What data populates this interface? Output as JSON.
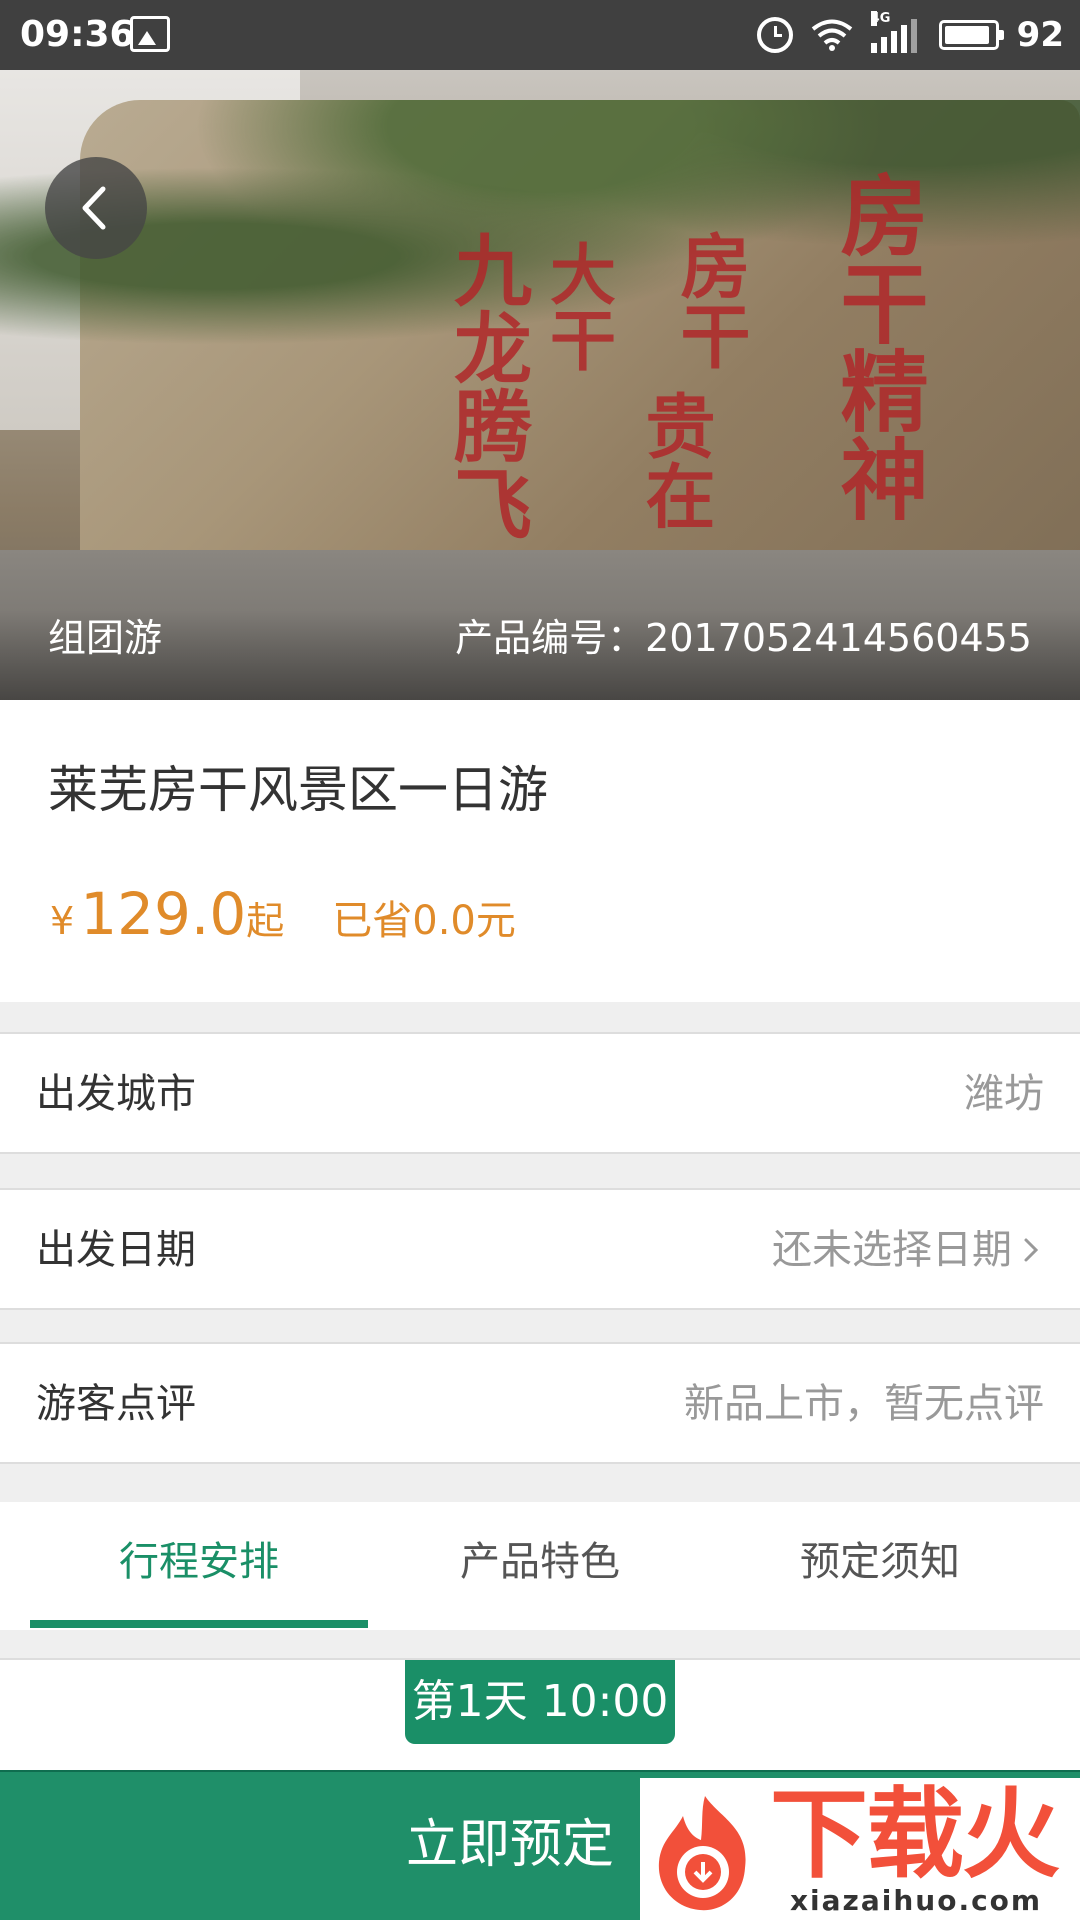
{
  "status_bar": {
    "time": "09:36",
    "network": "4G",
    "battery": "92"
  },
  "hero": {
    "tour_type": "组团游",
    "product_no": "产品编号：2017052414560455",
    "calligraphy": [
      "房干精神",
      "贵在",
      "房干",
      "大干",
      "九龙腾飞"
    ]
  },
  "product": {
    "title": "莱芜房干风景区一日游",
    "currency": "¥",
    "price": "129.0",
    "price_suffix": "起",
    "saved": "已省0.0元"
  },
  "info_rows": {
    "departure_city": {
      "label": "出发城市",
      "value": "潍坊"
    },
    "departure_date": {
      "label": "出发日期",
      "value": "还未选择日期"
    },
    "reviews": {
      "label": "游客点评",
      "value": "新品上市，暂无点评"
    }
  },
  "tabs": [
    "行程安排",
    "产品特色",
    "预定须知"
  ],
  "itinerary": {
    "day_badge": "第1天 10:00"
  },
  "cta": {
    "book_now": "立即预定"
  },
  "watermark": {
    "brand": "下载火",
    "url": "xiazaihuo.com"
  },
  "colors": {
    "accent": "#1a8f67",
    "price": "#e08b2a",
    "status_bar": "#404040"
  }
}
